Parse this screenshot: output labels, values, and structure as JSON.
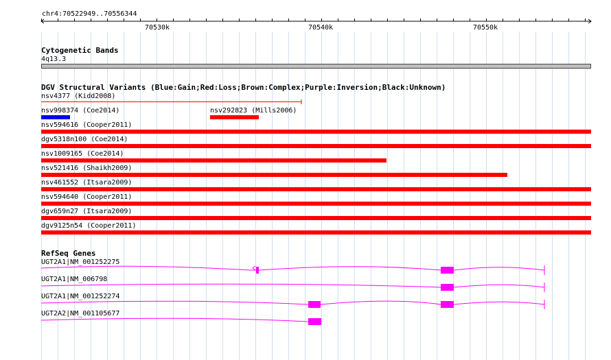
{
  "region": "chr4:70522949..70556344",
  "ruler": {
    "ticks": [
      "70530k",
      "70540k",
      "70550k"
    ]
  },
  "cytoband": {
    "title": "Cytogenetic Bands",
    "band": "4q13.3",
    "color": "#c0c0c0"
  },
  "dgv": {
    "title": "DGV Structural Variants (Blue:Gain;Red:Loss;Brown:Complex;Purple:Inversion;Black:Unknown)",
    "colors": {
      "gain": "#0000ee",
      "loss": "#ff0000"
    },
    "variants": [
      {
        "label": "nsv4377 (Kidd2008)",
        "type": "loss",
        "style": "thin"
      },
      {
        "label": "nsv998374 (Coe2014)",
        "type": "gain"
      },
      {
        "label": "nsv292823 (Mills2006)",
        "type": "loss"
      },
      {
        "label": "nsv594616 (Cooper2011)",
        "type": "loss"
      },
      {
        "label": "dgv5318n100 (Coe2014)",
        "type": "loss"
      },
      {
        "label": "nsv1009165 (Coe2014)",
        "type": "loss"
      },
      {
        "label": "nsv521416 (Shaikh2009)",
        "type": "loss"
      },
      {
        "label": "nsv461552 (Itsara2009)",
        "type": "loss"
      },
      {
        "label": "nsv594640 (Cooper2011)",
        "type": "loss"
      },
      {
        "label": "dgv659n27 (Itsara2009)",
        "type": "loss"
      },
      {
        "label": "dgv9125n54 (Cooper2011)",
        "type": "loss"
      }
    ]
  },
  "refseq": {
    "title": "RefSeq Genes",
    "color": "#ff00ff",
    "transcripts": [
      {
        "label": "UGT2A1|NM_001252275"
      },
      {
        "label": "UGT2A1|NM_006798"
      },
      {
        "label": "UGT2A1|NM_001252274"
      },
      {
        "label": "UGT2A2|NM_001105677"
      }
    ]
  }
}
